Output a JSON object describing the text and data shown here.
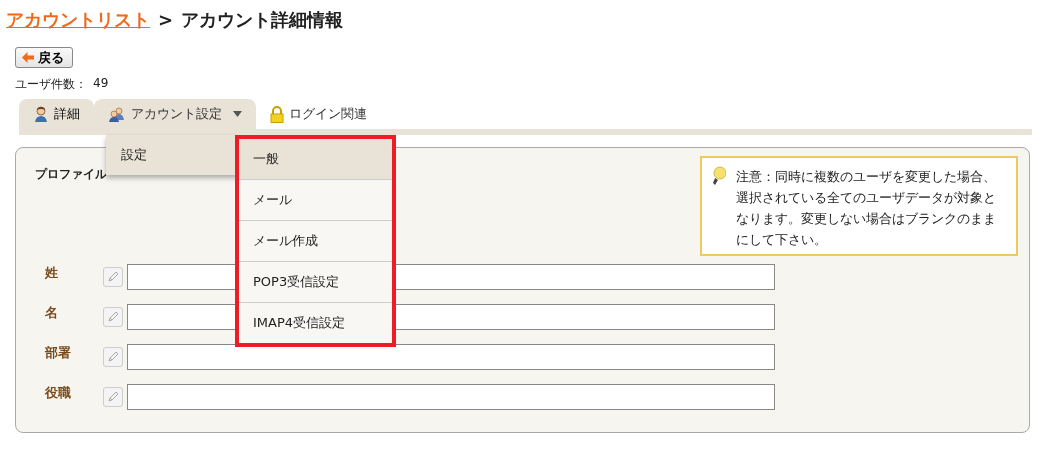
{
  "breadcrumb": {
    "link": "アカウントリスト",
    "separator": ">",
    "current": "アカウント詳細情報"
  },
  "back_button": {
    "label": "戻る"
  },
  "user_count": {
    "label": "ユーザ件数：",
    "value": "49"
  },
  "tabs": [
    {
      "label": "詳細",
      "selected": true,
      "open": false,
      "dropdown": false
    },
    {
      "label": "アカウント設定",
      "selected": false,
      "open": true,
      "dropdown": true
    },
    {
      "label": "ログイン関連",
      "selected": false,
      "open": false,
      "dropdown": false
    }
  ],
  "menu": {
    "items": [
      {
        "label": "設定",
        "selected": true
      }
    ],
    "submenu": {
      "annotated": true,
      "items": [
        {
          "label": "一般",
          "selected": true
        },
        {
          "label": "メール",
          "selected": false
        },
        {
          "label": "メール作成",
          "selected": false
        },
        {
          "label": "POP3受信設定",
          "selected": false
        },
        {
          "label": "IMAP4受信設定",
          "selected": false
        }
      ]
    }
  },
  "panel": {
    "title": "プロファイル",
    "note": "注意：同時に複数のユーザを変更した場合、選択されている全てのユーザデータが対象となります。変更しない場合はブランクのままにして下さい。",
    "fields": [
      {
        "label": "姓"
      },
      {
        "label": "名"
      },
      {
        "label": "部署"
      },
      {
        "label": "役職"
      }
    ]
  }
}
